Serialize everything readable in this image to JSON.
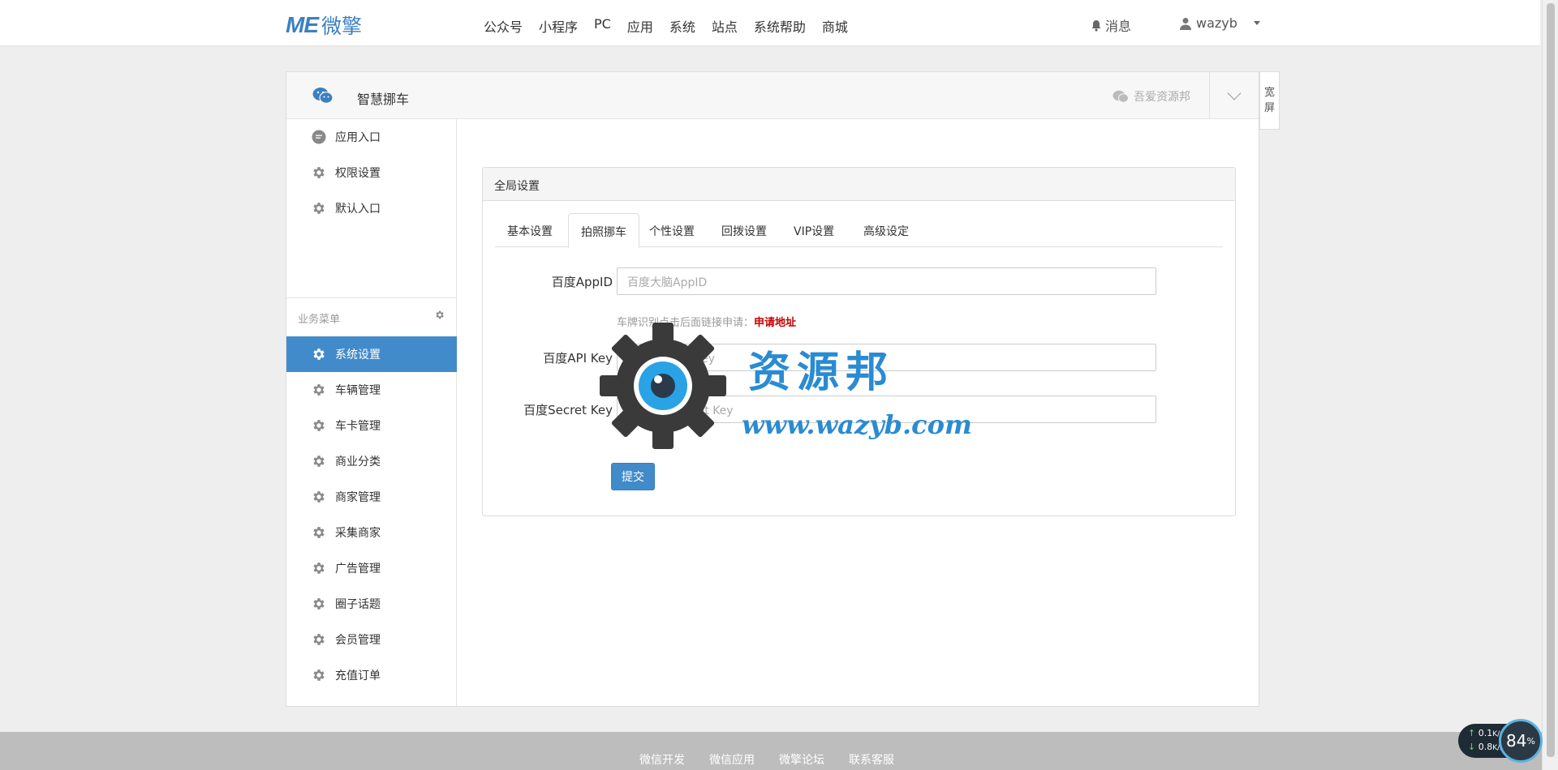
{
  "topnav": {
    "logo_mark": "ME",
    "logo_text": "微擎",
    "menu": [
      "公众号",
      "小程序",
      "PC",
      "应用",
      "系统",
      "站点",
      "系统帮助",
      "商城"
    ],
    "messages": "消息",
    "user": "wazyb"
  },
  "panel": {
    "app_name": "智慧挪车",
    "account": "吾爱资源邦",
    "wide_screen": [
      "宽",
      "屏"
    ]
  },
  "sidebar": {
    "top_items": [
      {
        "label": "应用入口",
        "icon": "chat-bubble-icon"
      },
      {
        "label": "权限设置",
        "icon": "gear-icon"
      },
      {
        "label": "默认入口",
        "icon": "gear-icon"
      }
    ],
    "group_title": "业务菜单",
    "items": [
      {
        "label": "系统设置",
        "active": true
      },
      {
        "label": "车辆管理"
      },
      {
        "label": "车卡管理"
      },
      {
        "label": "商业分类"
      },
      {
        "label": "商家管理"
      },
      {
        "label": "采集商家"
      },
      {
        "label": "广告管理"
      },
      {
        "label": "圈子话题"
      },
      {
        "label": "会员管理"
      },
      {
        "label": "充值订单"
      }
    ]
  },
  "content": {
    "card_title": "全局设置",
    "tabs": [
      "基本设置",
      "拍照挪车",
      "个性设置",
      "回拨设置",
      "VIP设置",
      "高级设定"
    ],
    "active_tab": "拍照挪车",
    "fields": [
      {
        "label": "百度AppID",
        "placeholder": "百度大脑AppID"
      },
      {
        "label": "百度API Key",
        "placeholder": "百度大脑API Key"
      },
      {
        "label": "百度Secret Key",
        "placeholder": "百度大脑Secret Key"
      }
    ],
    "hint_text": "车牌识别点击后面链接申请：",
    "hint_link": "申请地址",
    "submit": "提交"
  },
  "watermark": {
    "title": "资源邦",
    "url": "www.wazyb.com"
  },
  "footer": {
    "links": [
      "微信开发",
      "微信应用",
      "微擎论坛",
      "联系客服"
    ]
  },
  "net_widget": {
    "up": "0.1",
    "down": "0.8",
    "unit": "K/s",
    "percent": "84",
    "percent_sign": "%"
  },
  "colors": {
    "accent": "#428bca",
    "brand": "#3a80c0",
    "link_red": "#c40000",
    "watermark_blue": "#2a8bd2"
  }
}
